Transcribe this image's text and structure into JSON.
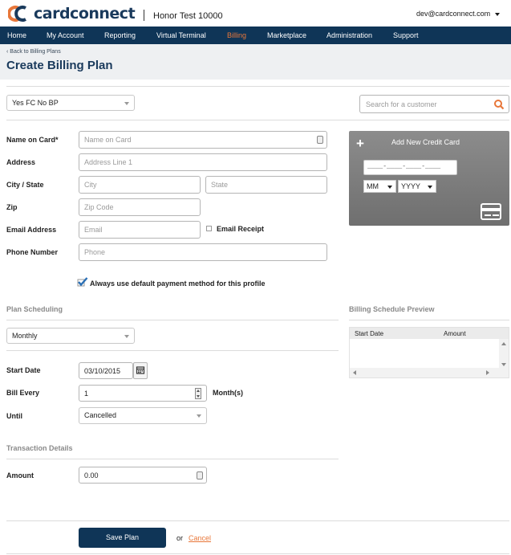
{
  "brand": {
    "logo_text": "cardconnect",
    "accent_color": "#e8773a",
    "navy_color": "#0f3557"
  },
  "header": {
    "merchant_name": "Honor Test 10000",
    "user_email": "dev@cardconnect.com"
  },
  "nav": {
    "items": [
      "Home",
      "My Account",
      "Reporting",
      "Virtual Terminal",
      "Billing",
      "Marketplace",
      "Administration",
      "Support"
    ],
    "active": "Billing"
  },
  "page": {
    "back_link": "‹ Back to Billing Plans",
    "title": "Create Billing Plan"
  },
  "profile_select": {
    "value": "Yes FC No BP"
  },
  "search": {
    "placeholder": "Search for a customer",
    "icon": "search-icon"
  },
  "form": {
    "name_label": "Name on Card*",
    "name_placeholder": "Name on Card",
    "address_label": "Address",
    "address_placeholder": "Address Line 1",
    "city_state_label": "City / State",
    "city_placeholder": "City",
    "state_placeholder": "State",
    "zip_label": "Zip",
    "zip_placeholder": "Zip Code",
    "email_label": "Email Address",
    "email_placeholder": "Email",
    "email_receipt_label": "Email Receipt",
    "phone_label": "Phone Number",
    "phone_placeholder": "Phone",
    "default_payment_label": "Always use default payment method for this profile",
    "default_payment_checked": true
  },
  "card": {
    "title": "Add New Credit Card",
    "number_mask": "____-____-____-____",
    "month": "MM",
    "year": "YYYY"
  },
  "plan_scheduling": {
    "section_label": "Plan Scheduling",
    "frequency": "Monthly",
    "start_date_label": "Start Date",
    "start_date": "03/10/2015",
    "bill_every_label": "Bill Every",
    "bill_every": "1",
    "bill_every_unit": "Month(s)",
    "until_label": "Until",
    "until": "Cancelled"
  },
  "preview": {
    "section_label": "Billing Schedule Preview",
    "columns": [
      "Start Date",
      "Amount"
    ]
  },
  "transaction": {
    "section_label": "Transaction Details",
    "amount_label": "Amount",
    "amount": "0.00"
  },
  "actions": {
    "save_label": "Save Plan",
    "or_text": "or",
    "cancel_label": "Cancel"
  }
}
